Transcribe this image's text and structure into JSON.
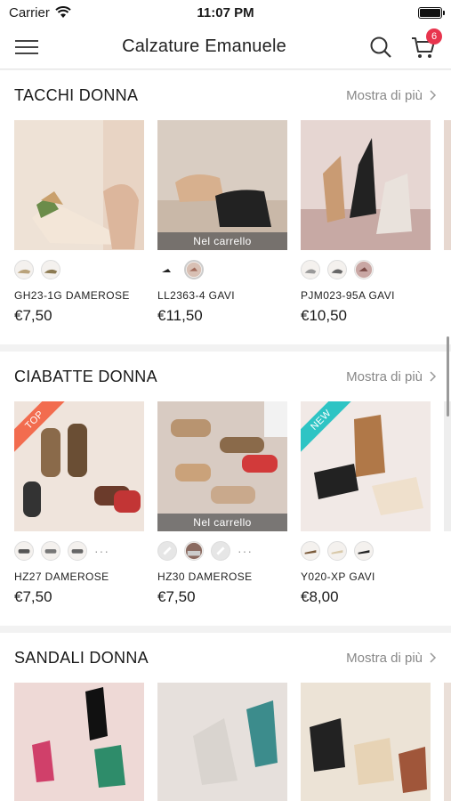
{
  "status": {
    "carrier": "Carrier",
    "time": "11:07 PM"
  },
  "header": {
    "title": "Calzature Emanuele",
    "cart_count": "6"
  },
  "colors": {
    "badge": "#e8354e",
    "ribbon_top": "#f26c4f",
    "ribbon_new": "#2ec4c4"
  },
  "sections": [
    {
      "title": "TACCHI DONNA",
      "more_label": "Mostra di più",
      "products": [
        {
          "name": "GH23-1G DAMEROSE",
          "price": "€7,50",
          "in_cart": "",
          "ribbon": ""
        },
        {
          "name": "LL2363-4 GAVI",
          "price": "€11,50",
          "in_cart": "Nel carrello",
          "ribbon": ""
        },
        {
          "name": "PJM023-95A GAVI",
          "price": "€10,50",
          "in_cart": "",
          "ribbon": ""
        }
      ]
    },
    {
      "title": "CIABATTE DONNA",
      "more_label": "Mostra di più",
      "products": [
        {
          "name": "HZ27 DAMEROSE",
          "price": "€7,50",
          "in_cart": "",
          "ribbon": "TOP",
          "more_swatches": "···"
        },
        {
          "name": "HZ30 DAMEROSE",
          "price": "€7,50",
          "in_cart": "Nel carrello",
          "ribbon": "",
          "more_swatches": "···"
        },
        {
          "name": "Y020-XP GAVI",
          "price": "€8,00",
          "in_cart": "",
          "ribbon": "NEW"
        }
      ]
    },
    {
      "title": "SANDALI DONNA",
      "more_label": "Mostra di più",
      "products": [
        {},
        {},
        {}
      ]
    }
  ]
}
